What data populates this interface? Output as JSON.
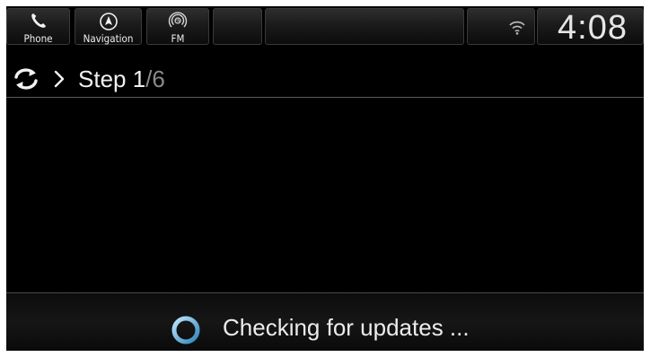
{
  "topbar": {
    "tabs": [
      {
        "label": "Phone",
        "icon": "phone-icon"
      },
      {
        "label": "Navigation",
        "icon": "navigation-icon"
      },
      {
        "label": "FM",
        "icon": "radio-icon",
        "icon_text": "FM"
      }
    ],
    "wifi_icon": "wifi-icon",
    "clock": "4:08"
  },
  "header": {
    "refresh_icon": "refresh-icon",
    "chevron_icon": "chevron-right-icon",
    "step_prefix": "Step 1",
    "step_suffix": "/6"
  },
  "footer": {
    "spinner_icon": "spinner-icon",
    "status": "Checking for updates ..."
  },
  "colors": {
    "background": "#000000",
    "text": "#f0f0f0",
    "text_dim": "#8a8a8a",
    "spinner": "#6fb8e0",
    "divider": "#5a5a5a"
  }
}
